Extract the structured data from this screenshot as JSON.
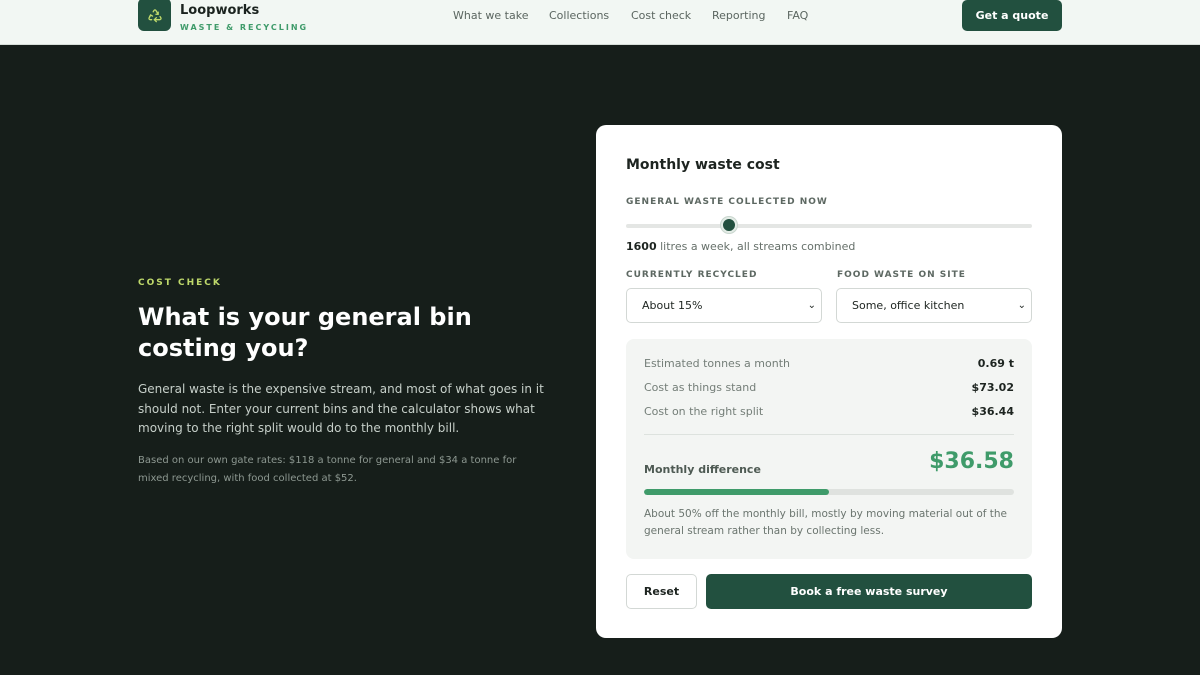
{
  "header": {
    "brand_name": "Loopworks",
    "brand_tagline": "WASTE & RECYCLING",
    "logo_icon": "recycle-icon",
    "nav": [
      {
        "label": "What we take"
      },
      {
        "label": "Collections"
      },
      {
        "label": "Cost check"
      },
      {
        "label": "Reporting"
      },
      {
        "label": "FAQ"
      }
    ],
    "cta_label": "Get a quote"
  },
  "intro": {
    "eyebrow": "COST CHECK",
    "headline": "What is your general bin costing you?",
    "body": "General waste is the expensive stream, and most of what goes in it should not. Enter your current bins and the calculator shows what moving to the right split would do to the monthly bill.",
    "fineprint": "Based on our own gate rates: $118 a tonne for general and $34 a tonne for mixed recycling, with food collected at $52."
  },
  "calculator": {
    "title": "Monthly waste cost",
    "slider": {
      "label": "GENERAL WASTE COLLECTED NOW",
      "value": "1600",
      "unit_text": " litres a week, all streams combined",
      "position_fraction": 0.25
    },
    "recycled": {
      "label": "CURRENTLY RECYCLED",
      "selected": "About 15%"
    },
    "food": {
      "label": "FOOD WASTE ON SITE",
      "selected": "Some, office kitchen"
    },
    "results": {
      "rows": [
        {
          "label": "Estimated tonnes a month",
          "value": "0.69 t"
        },
        {
          "label": "Cost as things stand",
          "value": "$73.02"
        },
        {
          "label": "Cost on the right split",
          "value": "$36.44"
        }
      ],
      "difference_label": "Monthly difference",
      "difference_value": "$36.58",
      "difference_fraction": 0.5,
      "note": "About 50% off the monthly bill, mostly by moving material out of the general stream rather than by collecting less."
    },
    "reset_label": "Reset",
    "survey_label": "Book a free waste survey"
  },
  "colors": {
    "page_bg": "#161e1a",
    "brand_green": "#22503f",
    "accent_green": "#3f9b6a",
    "eyebrow_lime": "#bfd96b"
  }
}
